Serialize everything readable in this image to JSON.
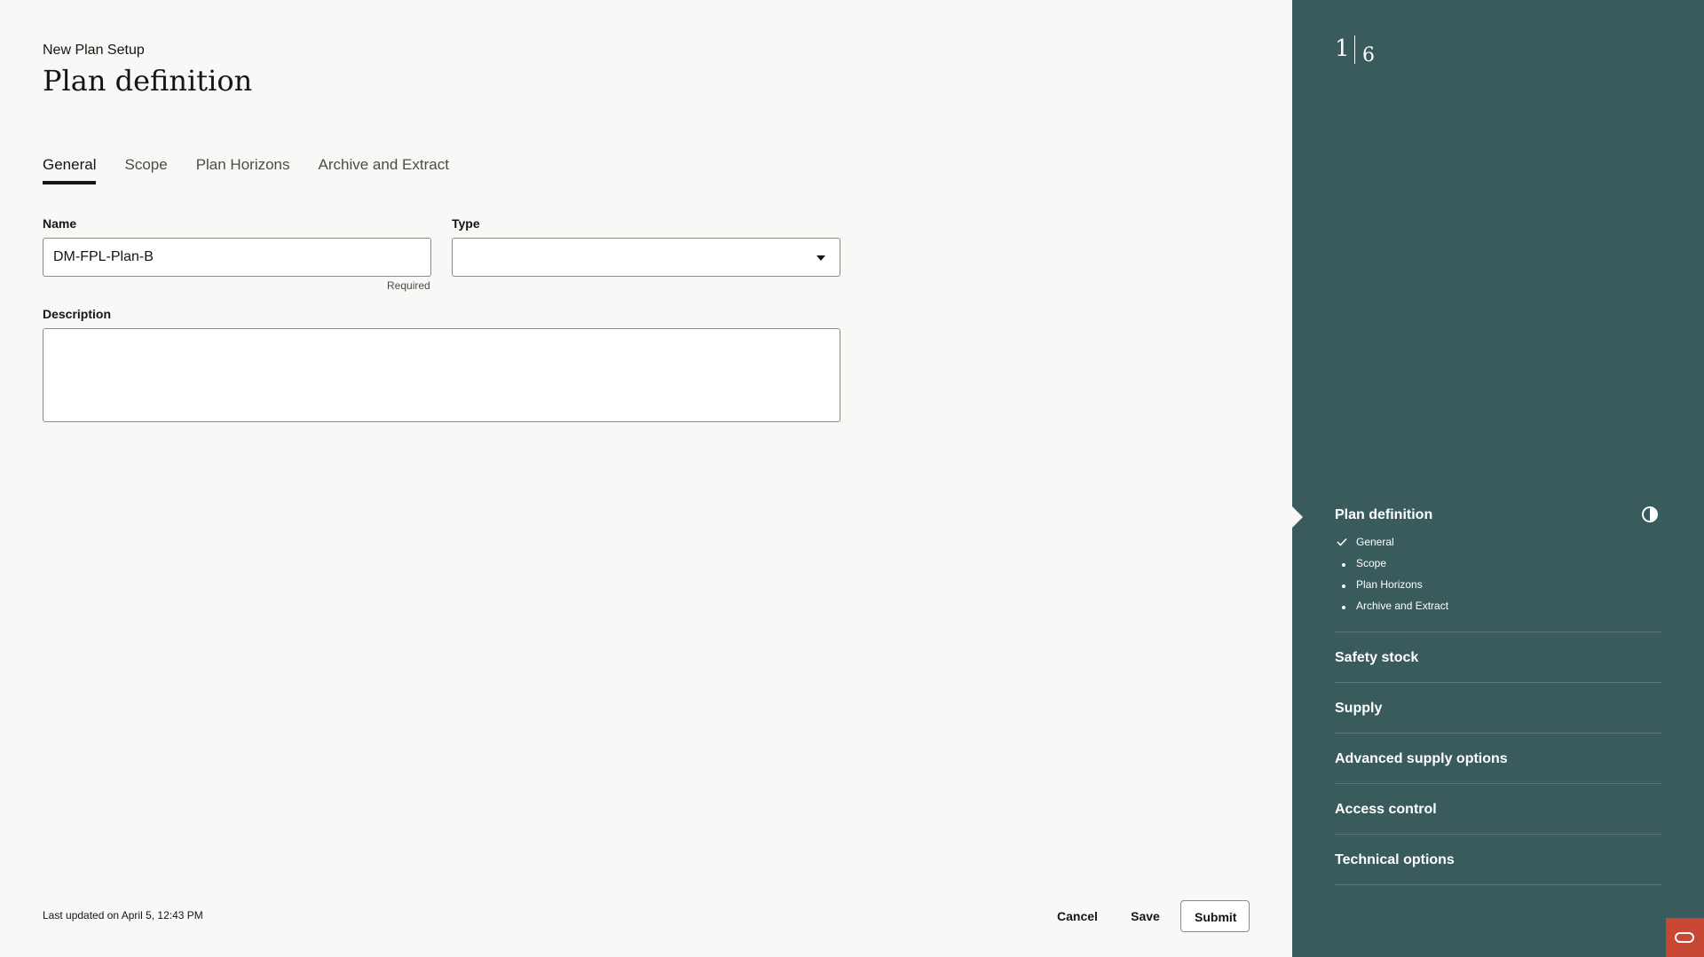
{
  "header": {
    "subtitle": "New Plan Setup",
    "title": "Plan definition"
  },
  "tabs": [
    {
      "label": "General",
      "active": true
    },
    {
      "label": "Scope",
      "active": false
    },
    {
      "label": "Plan Horizons",
      "active": false
    },
    {
      "label": "Archive and Extract",
      "active": false
    }
  ],
  "form": {
    "name_label": "Name",
    "name_value": "DM-FPL-Plan-B",
    "name_helper": "Required",
    "type_label": "Type",
    "type_value": "",
    "description_label": "Description",
    "description_value": ""
  },
  "footer": {
    "last_updated": "Last updated on April 5, 12:43 PM",
    "cancel_label": "Cancel",
    "save_label": "Save",
    "submit_label": "Submit"
  },
  "panel": {
    "current_step": "1",
    "total_steps": "6",
    "sections": [
      {
        "label": "Plan definition",
        "current": true
      },
      {
        "label": "Safety stock"
      },
      {
        "label": "Supply"
      },
      {
        "label": "Advanced supply options"
      },
      {
        "label": "Access control"
      },
      {
        "label": "Technical options"
      }
    ],
    "substeps": [
      {
        "label": "General",
        "status": "complete"
      },
      {
        "label": "Scope",
        "status": "pending"
      },
      {
        "label": "Plan Horizons",
        "status": "pending"
      },
      {
        "label": "Archive and Extract",
        "status": "pending"
      }
    ],
    "icons": {
      "progress": "half-contrast-icon",
      "complete": "checkmark-icon",
      "brand": "oracle-logo-icon"
    },
    "colors": {
      "panel_bg": "#3a5b5c",
      "brand": "#c74634"
    }
  }
}
